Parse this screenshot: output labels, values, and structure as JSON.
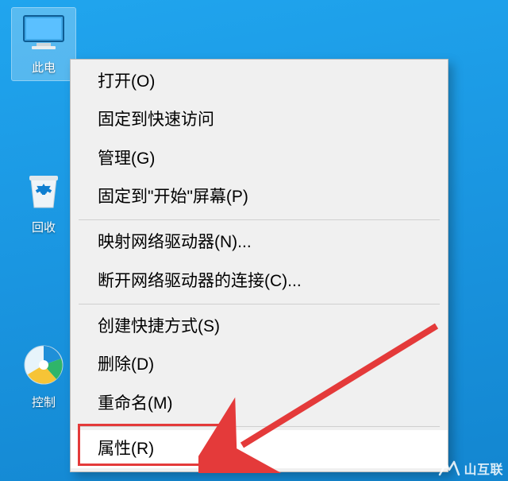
{
  "desktop": {
    "icons": [
      {
        "id": "this-pc",
        "label": "此电",
        "selected": true
      },
      {
        "id": "recycle-bin",
        "label": "回收",
        "selected": false
      },
      {
        "id": "control-panel",
        "label": "控制",
        "selected": false
      }
    ]
  },
  "context_menu": {
    "groups": [
      [
        {
          "id": "open",
          "label": "打开(O)"
        },
        {
          "id": "pin-quick-access",
          "label": "固定到快速访问"
        },
        {
          "id": "manage",
          "label": "管理(G)"
        },
        {
          "id": "pin-start",
          "label": "固定到\"开始\"屏幕(P)"
        }
      ],
      [
        {
          "id": "map-drive",
          "label": "映射网络驱动器(N)..."
        },
        {
          "id": "disconnect-drive",
          "label": "断开网络驱动器的连接(C)..."
        }
      ],
      [
        {
          "id": "create-shortcut",
          "label": "创建快捷方式(S)"
        },
        {
          "id": "delete",
          "label": "删除(D)"
        },
        {
          "id": "rename",
          "label": "重命名(M)"
        }
      ],
      [
        {
          "id": "properties",
          "label": "属性(R)",
          "hover": true,
          "highlighted": true
        }
      ]
    ]
  },
  "watermark": {
    "text": "山互联"
  },
  "annotation": {
    "highlight_target": "properties",
    "arrow_color": "#e43a3a"
  }
}
